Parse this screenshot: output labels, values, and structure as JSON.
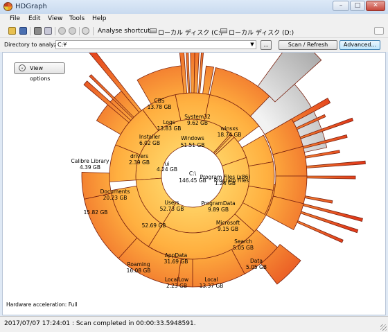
{
  "window": {
    "title": "HDGraph",
    "min_glyph": "–",
    "max_glyph": "□",
    "close_glyph": "✕"
  },
  "menu": {
    "file": "File",
    "edit": "Edit",
    "view": "View",
    "tools": "Tools",
    "help": "Help"
  },
  "toolbar": {
    "analyse_shortcuts": "Analyse shortcuts:",
    "drive_c": "ローカル ディスク (C:)",
    "drive_d": "ローカル ディスク (D:)",
    "icons": [
      "open-icon",
      "save-icon",
      "print-icon",
      "print-preview-icon",
      "back-icon",
      "forward-icon",
      "help-icon"
    ]
  },
  "address": {
    "label": "Directory to analyze :",
    "value": "C:¥",
    "browse_label": "...",
    "scan_label": "Scan / Refresh",
    "advanced_label": "Advanced..."
  },
  "view_options": {
    "label": "View options",
    "glyph": "⌄"
  },
  "hw_accel": "Hardware acceleration: Full",
  "status": "2017/07/07 17:24:01 : Scan completed in 00:00:33.5948591.",
  "colors": {
    "ring_outer": "#e2421c",
    "ring_mid": "#f88530",
    "ring_light": "#ffd060",
    "center": "#fff6b0",
    "stroke": "#7a2210",
    "grey_segment": "#b8b8b8"
  },
  "sunburst": {
    "root": {
      "label": "C:\\",
      "size": "146.45 GB"
    },
    "segments": [
      {
        "ring": 1,
        "label": "Windows",
        "size": "51.51 GB"
      },
      {
        "ring": 1,
        "label": "Users",
        "size": "52.73 GB"
      },
      {
        "ring": 1,
        "label": "Program Files (x86)",
        "size": "1.24 GB"
      },
      {
        "ring": 1,
        "label": "ProgramData",
        "size": "9.89 GB"
      },
      {
        "ring": 1,
        "label": "Program Files",
        "size": ""
      },
      {
        "ring": 1,
        "label": "ui",
        "size": "4.24 GB"
      },
      {
        "ring": 2,
        "label": "Installer",
        "size": "6.02 GB"
      },
      {
        "ring": 2,
        "label": "Logs",
        "size": "13.83 GB"
      },
      {
        "ring": 2,
        "label": "System32",
        "size": "9.62 GB"
      },
      {
        "ring": 2,
        "label": "winsxs",
        "size": "18.74 GB"
      },
      {
        "ring": 2,
        "label": "drivers",
        "size": "2.39 GB"
      },
      {
        "ring": 2,
        "label": "Documents",
        "size": "20.23 GB"
      },
      {
        "ring": 2,
        "label": "",
        "size": "52.69 GB"
      },
      {
        "ring": 2,
        "label": "AppData",
        "size": "31.69 GB"
      },
      {
        "ring": 2,
        "label": "Microsoft",
        "size": "9.15 GB"
      },
      {
        "ring": 3,
        "label": "CBS",
        "size": "13.78 GB"
      },
      {
        "ring": 3,
        "label": "Calibre Library",
        "size": "4.39 GB"
      },
      {
        "ring": 3,
        "label": "",
        "size": "15.82 GB"
      },
      {
        "ring": 3,
        "label": "Roaming",
        "size": "16.08 GB"
      },
      {
        "ring": 3,
        "label": "LocalLow",
        "size": "2.23 GB"
      },
      {
        "ring": 3,
        "label": "Local",
        "size": "13.37 GB"
      },
      {
        "ring": 3,
        "label": "Search",
        "size": "5.05 GB"
      },
      {
        "ring": 4,
        "label": "Data",
        "size": "5.05 GB"
      }
    ]
  }
}
